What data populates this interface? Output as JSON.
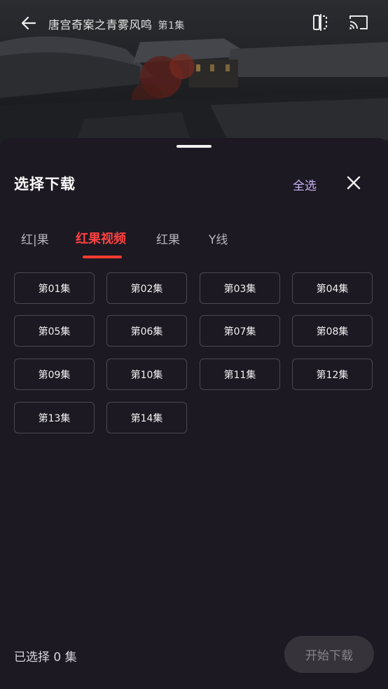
{
  "header": {
    "title": "唐宫奇案之青雾风鸣",
    "episode": "第1集"
  },
  "sheet": {
    "title": "选择下载",
    "select_all": "全选"
  },
  "tabs": [
    {
      "label": "红|果",
      "active": false
    },
    {
      "label": "红果视频",
      "active": true
    },
    {
      "label": "红果",
      "active": false
    },
    {
      "label": "Y线",
      "active": false
    }
  ],
  "episodes": [
    "第01集",
    "第02集",
    "第03集",
    "第04集",
    "第05集",
    "第06集",
    "第07集",
    "第08集",
    "第09集",
    "第10集",
    "第11集",
    "第12集",
    "第13集",
    "第14集"
  ],
  "footer": {
    "status": "已选择 0 集",
    "start_label": "开始下载"
  },
  "colors": {
    "accent_red": "#ff3b30",
    "select_all": "#c8b3f5",
    "sheet_bg": "#1c1922"
  }
}
